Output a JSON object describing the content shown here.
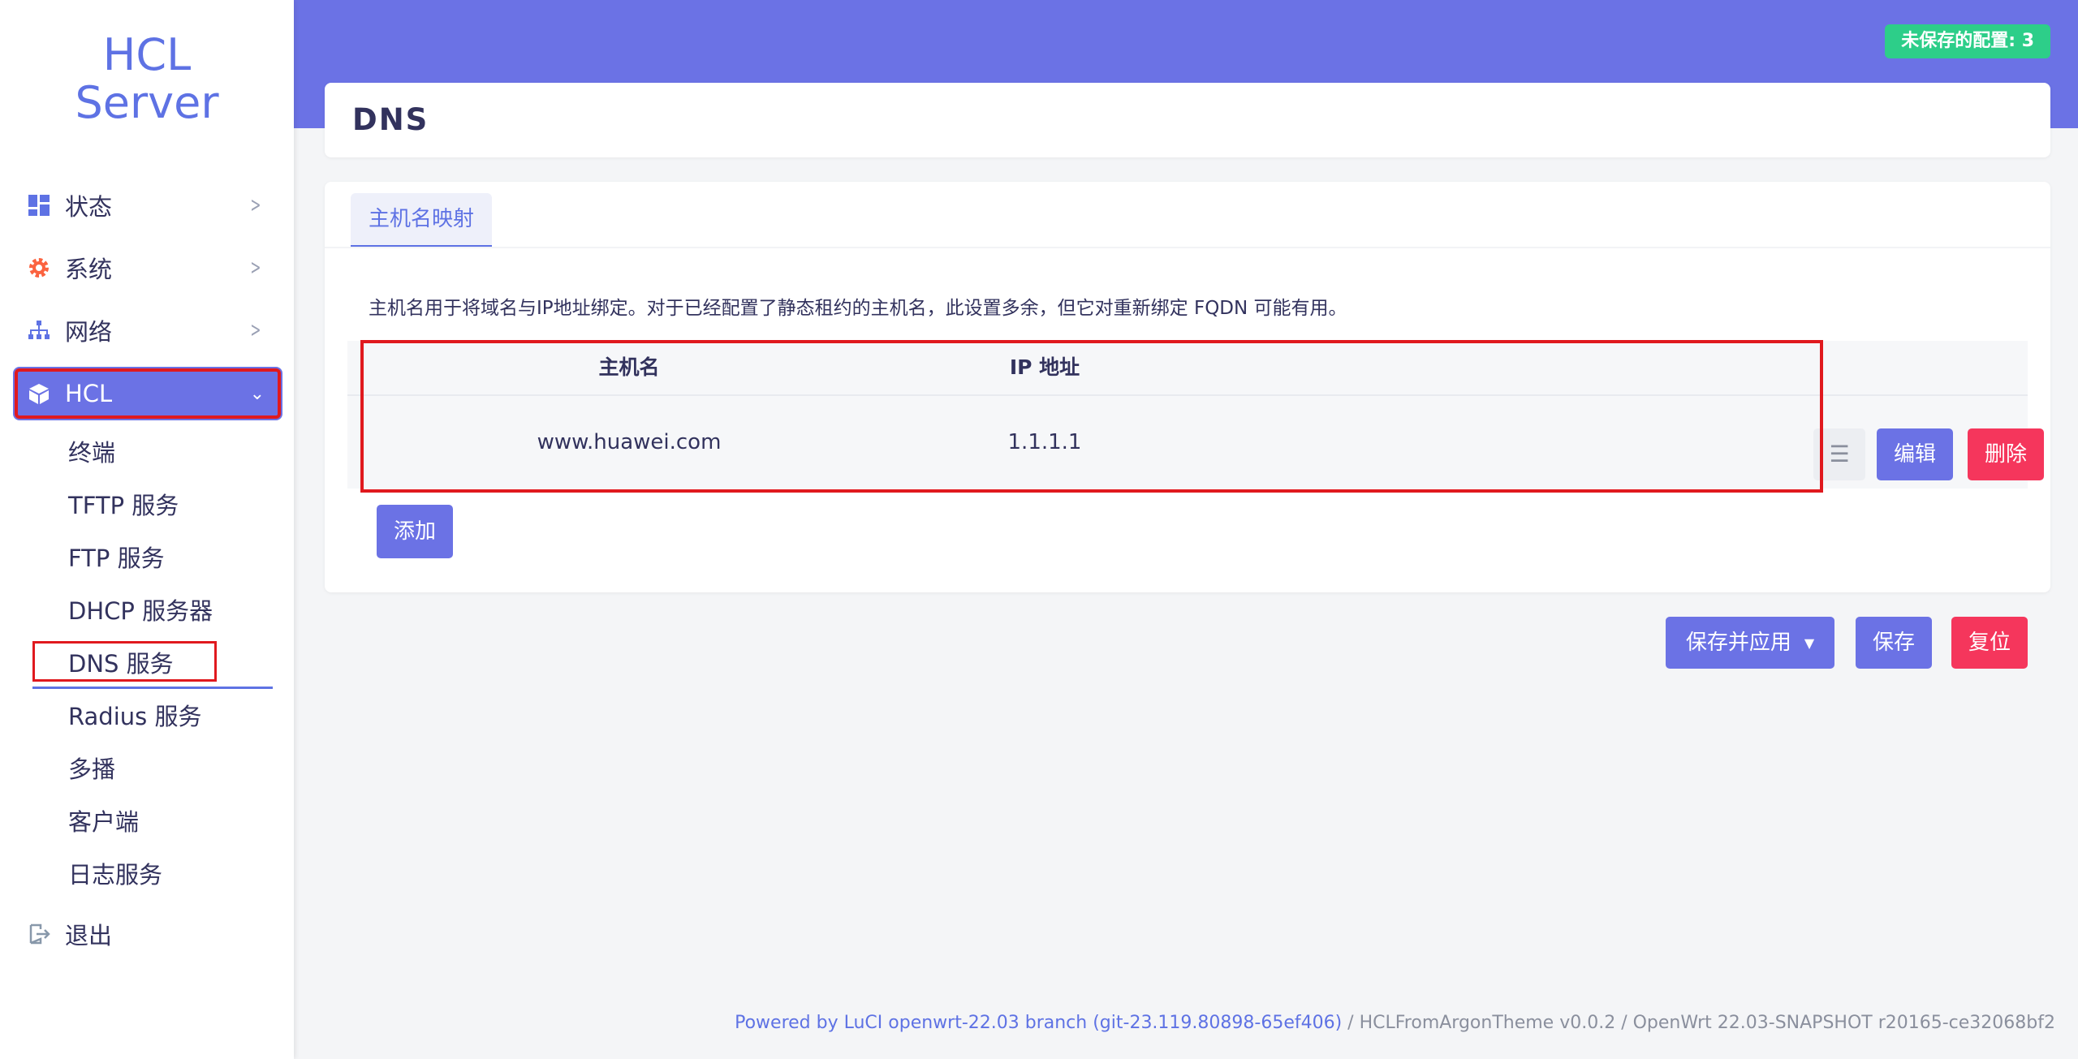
{
  "brand": {
    "line1": "HCL",
    "line2": "Server"
  },
  "sidebar": {
    "items": [
      {
        "label": "状态",
        "icon": "dashboard-icon"
      },
      {
        "label": "系统",
        "icon": "gear-icon"
      },
      {
        "label": "网络",
        "icon": "network-icon"
      },
      {
        "label": "HCL",
        "icon": "cube-icon"
      }
    ],
    "subitems": [
      "终端",
      "TFTP 服务",
      "FTP 服务",
      "DHCP 服务器",
      "DNS 服务",
      "Radius 服务",
      "多播",
      "客户端",
      "日志服务"
    ],
    "logout": {
      "label": "退出",
      "icon": "logout-icon"
    }
  },
  "header": {
    "unsaved_badge": "未保存的配置: 3"
  },
  "page": {
    "title": "DNS"
  },
  "tabs": [
    {
      "label": "主机名映射"
    }
  ],
  "description": "主机名用于将域名与IP地址绑定。对于已经配置了静态租约的主机名，此设置多余，但它对重新绑定 FQDN 可能有用。",
  "table": {
    "headers": {
      "hostname": "主机名",
      "ip": "IP 地址"
    },
    "rows": [
      {
        "hostname": "www.huawei.com",
        "ip": "1.1.1.1"
      }
    ],
    "row_actions": {
      "drag": "☰",
      "edit": "编辑",
      "delete": "删除"
    }
  },
  "add_button": "添加",
  "actions": {
    "save_apply": "保存并应用",
    "save": "保存",
    "reset": "复位"
  },
  "footer": {
    "luci": "Powered by LuCI openwrt-22.03 branch (git-23.119.80898-65ef406)",
    "rest": " / HCLFromArgonTheme v0.0.2 / OpenWrt 22.03-SNAPSHOT r20165-ce32068bf2"
  },
  "colors": {
    "accent": "#6b72e5",
    "danger": "#f5365c",
    "success": "#2dce89",
    "highlight": "#e0191e"
  }
}
